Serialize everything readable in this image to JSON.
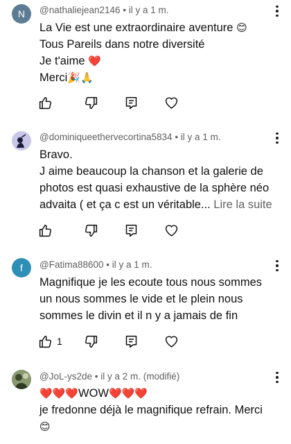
{
  "comments": [
    {
      "avatar_letter": "N",
      "avatar_color": "#5c7c94",
      "author": "@nathaliejean2146",
      "time": " • il y a 1 m.",
      "lines": [
        "La Vie est une extraordinaire aventure",
        "Tous Pareils dans notre diversité",
        "Je t'aime",
        "Merci"
      ],
      "emoji": [
        "😊",
        "❤️",
        "🎉🙏"
      ],
      "likes": ""
    },
    {
      "avatar_letter": "",
      "avatar_color": "#c9c6e8",
      "author": "@dominiqueethervecortina5834",
      "time": " • il y a 1 m.",
      "lines": [
        "Bravo.",
        "J aime beaucoup la chanson et la galerie de",
        "photos est quasi exhaustive de la sphère néo",
        "advaita ( et ça c est un véritable..."
      ],
      "read_more": " Lire la suite",
      "likes": ""
    },
    {
      "avatar_letter": "f",
      "avatar_color": "#2e8fb6",
      "author": "@Fatima88600",
      "time": " • il y a 1 m.",
      "lines": [
        "Magnifique je les ecoute tous nous sommes",
        "un nous sommes le vide et le plein nous",
        "sommes le divin et il n y a jamais de fin"
      ],
      "likes": "1"
    },
    {
      "avatar_letter": "",
      "avatar_color": "#6a7d5c",
      "author": "@JoL-ys2de",
      "time": " • il y a 2 m. (modifié)",
      "lines": [
        "WOW",
        " je fredonne déjà le magnifique refrain. Merci"
      ],
      "hearts_left": "❤️❤️❤️",
      "hearts_right": "❤️❤️❤️",
      "smile": "😊",
      "likes": ""
    }
  ],
  "icons": [
    "thumbs-up-icon",
    "thumbs-down-icon",
    "reply-icon",
    "heart-icon",
    "more-vert-icon"
  ],
  "colors": {
    "meta": "#606060",
    "text": "#0f0f0f",
    "background": "#ffffff"
  }
}
